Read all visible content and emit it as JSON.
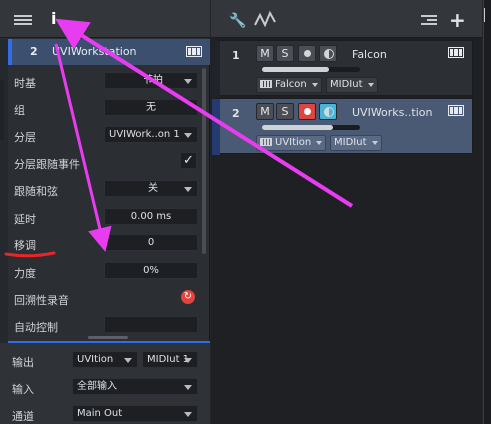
{
  "inspector": {
    "info_label": "i",
    "track_number": "2",
    "track_name": "UVIWorkstation",
    "properties": [
      {
        "label": "时基",
        "value": "节拍"
      },
      {
        "label": "组",
        "value": "无"
      },
      {
        "label": "分层",
        "value": "UVIWork..on 1"
      },
      {
        "label": "分层跟随事件",
        "value": "✓"
      },
      {
        "label": "跟随和弦",
        "value": "关"
      },
      {
        "label": "延时",
        "value": "0.00 ms"
      },
      {
        "label": "移调",
        "value": "0"
      },
      {
        "label": "力度",
        "value": "0%"
      },
      {
        "label": "回溯性录音",
        "value": ""
      },
      {
        "label": "自动控制",
        "value": ""
      }
    ],
    "routing": {
      "output_label": "输出",
      "output_device": "UVItion",
      "output_channel": "MIDIut 1",
      "input_label": "输入",
      "input_value": "全部输入",
      "channel_label": "通道",
      "channel_value": "Main Out"
    }
  },
  "tracks": [
    {
      "number": "1",
      "mute": "M",
      "solo": "S",
      "name": "Falcon",
      "volume_fraction": 0.68,
      "instrument": "Falcon",
      "midi_out": "MIDIut",
      "selected": false,
      "record_armed": false,
      "monitor_on": false
    },
    {
      "number": "2",
      "mute": "M",
      "solo": "S",
      "name": "UVIWorks..tion",
      "volume_fraction": 0.72,
      "instrument": "UVItion",
      "midi_out": "MIDIut",
      "selected": true,
      "record_armed": true,
      "monitor_on": true
    }
  ],
  "colors": {
    "accent": "#2f6ee8",
    "record": "#e0443e",
    "monitor": "#47b5d6",
    "annotation_arrow": "#e83cf0",
    "annotation_underline": "#e8262a"
  }
}
